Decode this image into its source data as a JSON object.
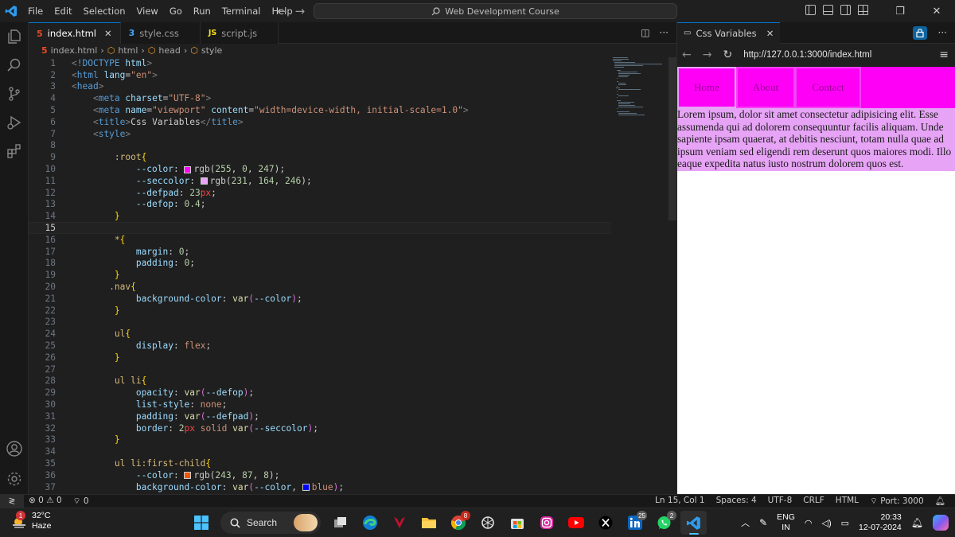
{
  "titlebar": {
    "menu": [
      "File",
      "Edit",
      "Selection",
      "View",
      "Go",
      "Run",
      "Terminal",
      "Help"
    ],
    "command_center": "Web Development Course"
  },
  "editor": {
    "tabs": [
      {
        "label": "index.html",
        "icon": "html5-icon",
        "active": true
      },
      {
        "label": "style.css",
        "icon": "css-icon",
        "active": false
      },
      {
        "label": "script.js",
        "icon": "js-icon",
        "active": false
      }
    ],
    "breadcrumb": [
      "index.html",
      "html",
      "head",
      "style"
    ],
    "current_line": 15,
    "lines": [
      {
        "n": 1,
        "html": "<span class='pu'>&lt;</span><span class='tg'>!DOCTYPE</span> <span class='at'>html</span><span class='pu'>&gt;</span>"
      },
      {
        "n": 2,
        "html": "<span class='pu'>&lt;</span><span class='tg'>html</span> <span class='at'>lang</span>=<span class='st'>\"en\"</span><span class='pu'>&gt;</span>"
      },
      {
        "n": 3,
        "html": "<span class='pu'>&lt;</span><span class='tg'>head</span><span class='pu'>&gt;</span>"
      },
      {
        "n": 4,
        "html": "    <span class='pu'>&lt;</span><span class='tg'>meta</span> <span class='at'>charset</span>=<span class='st'>\"UTF-8\"</span><span class='pu'>&gt;</span>"
      },
      {
        "n": 5,
        "html": "    <span class='pu'>&lt;</span><span class='tg'>meta</span> <span class='at'>name</span>=<span class='st'>\"viewport\"</span> <span class='at'>content</span>=<span class='st'>\"width=device-width, initial-scale=1.0\"</span><span class='pu'>&gt;</span>"
      },
      {
        "n": 6,
        "html": "    <span class='pu'>&lt;</span><span class='tg'>title</span><span class='pu'>&gt;</span>Css Variables<span class='pu'>&lt;/</span><span class='tg'>title</span><span class='pu'>&gt;</span>"
      },
      {
        "n": 7,
        "html": "    <span class='pu'>&lt;</span><span class='tg'>style</span><span class='pu'>&gt;</span>"
      },
      {
        "n": 8,
        "html": ""
      },
      {
        "n": 9,
        "html": "        <span class='sel'>:root</span><span class='br'>{</span>"
      },
      {
        "n": 10,
        "html": "            <span class='pr'>--color</span>: <span class='sw' style='background:#ff00f7'></span>rgb(<span class='nm'>255</span>, <span class='nm'>0</span>, <span class='nm'>247</span>);"
      },
      {
        "n": 11,
        "html": "            <span class='pr'>--seccolor</span>: <span class='sw' style='background:#e7a4f6'></span>rgb(<span class='nm'>231</span>, <span class='nm'>164</span>, <span class='nm'>246</span>);"
      },
      {
        "n": 12,
        "html": "            <span class='pr'>--defpad</span>: <span class='nm'>23</span><span class='un'>px</span>;"
      },
      {
        "n": 13,
        "html": "            <span class='pr'>--defop</span>: <span class='nm'>0.4</span>;"
      },
      {
        "n": 14,
        "html": "        <span class='br'>}</span>"
      },
      {
        "n": 15,
        "html": ""
      },
      {
        "n": 16,
        "html": "        <span class='sel'>*</span><span class='br'>{</span>"
      },
      {
        "n": 17,
        "html": "            <span class='pr'>margin</span>: <span class='nm'>0</span>;"
      },
      {
        "n": 18,
        "html": "            <span class='pr'>padding</span>: <span class='nm'>0</span>;"
      },
      {
        "n": 19,
        "html": "        <span class='br'>}</span>"
      },
      {
        "n": 20,
        "html": "       <span class='sel'>.nav</span><span class='br'>{</span>"
      },
      {
        "n": 21,
        "html": "            <span class='pr'>background-color</span>: <span class='fn'>var</span><span class='br2'>(</span><span class='pr'>--color</span><span class='br2'>)</span>;"
      },
      {
        "n": 22,
        "html": "        <span class='br'>}</span>"
      },
      {
        "n": 23,
        "html": ""
      },
      {
        "n": 24,
        "html": "        <span class='sel'>ul</span><span class='br'>{</span>"
      },
      {
        "n": 25,
        "html": "            <span class='pr'>display</span>: <span class='kw'>flex</span>;"
      },
      {
        "n": 26,
        "html": "        <span class='br'>}</span>"
      },
      {
        "n": 27,
        "html": ""
      },
      {
        "n": 28,
        "html": "        <span class='sel'>ul li</span><span class='br'>{</span>"
      },
      {
        "n": 29,
        "html": "            <span class='pr'>opacity</span>: <span class='fn'>var</span><span class='br2'>(</span><span class='pr'>--defop</span><span class='br2'>)</span>;"
      },
      {
        "n": 30,
        "html": "            <span class='pr'>list-style</span>: <span class='kw'>none</span>;"
      },
      {
        "n": 31,
        "html": "            <span class='pr'>padding</span>: <span class='fn'>var</span><span class='br2'>(</span><span class='pr'>--defpad</span><span class='br2'>)</span>;"
      },
      {
        "n": 32,
        "html": "            <span class='pr'>border</span>: <span class='nm'>2</span><span class='un'>px</span> <span class='kw'>solid</span> <span class='fn'>var</span><span class='br2'>(</span><span class='pr'>--seccolor</span><span class='br2'>)</span>;"
      },
      {
        "n": 33,
        "html": "        <span class='br'>}</span>"
      },
      {
        "n": 34,
        "html": ""
      },
      {
        "n": 35,
        "html": "        <span class='sel'>ul li:first-child</span><span class='br'>{</span>"
      },
      {
        "n": 36,
        "html": "            <span class='pr'>--color</span>: <span class='sw' style='background:#f35708'></span>rgb(<span class='nm'>243</span>, <span class='nm'>87</span>, <span class='nm'>8</span>);"
      },
      {
        "n": 37,
        "html": "            <span class='pr'>background-color</span>: <span class='fn'>var</span><span class='br2'>(</span><span class='pr'>--color</span>, <span class='sw' style='background:#0000ff'></span><span class='kw'>blue</span><span class='br2'>)</span>;"
      }
    ]
  },
  "preview": {
    "tab_label": "Css Variables",
    "url": "http://127.0.0.1:3000/index.html",
    "nav_items": [
      "Home",
      "About",
      "Contact"
    ],
    "paragraph": "Lorem ipsum, dolor sit amet consectetur adipisicing elit. Esse assumenda qui ad dolorem consequuntur facilis aliquam. Unde sapiente ipsam quaerat, at debitis nesciunt, totam nulla quae ad ipsum veniam sed eligendi rem deserunt quos maiores modi. Illo eaque expedita natus iusto nostrum dolorem quos est.",
    "colors": {
      "nav": "#ff00f7",
      "secondary": "#e7a4f6"
    }
  },
  "statusbar": {
    "errors": "0",
    "warnings": "0",
    "ports": "0",
    "position": "Ln 15, Col 1",
    "spaces": "Spaces: 4",
    "encoding": "UTF-8",
    "eol": "CRLF",
    "language": "HTML",
    "port": "Port: 3000"
  },
  "taskbar": {
    "weather_temp": "32°C",
    "weather_desc": "Haze",
    "weather_badge": "1",
    "search": "Search",
    "chrome_badge": "8",
    "linkedin_badge": "25",
    "whatsapp_badge": "2",
    "lang_line1": "ENG",
    "lang_line2": "IN",
    "time": "20:33",
    "date": "12-07-2024"
  }
}
